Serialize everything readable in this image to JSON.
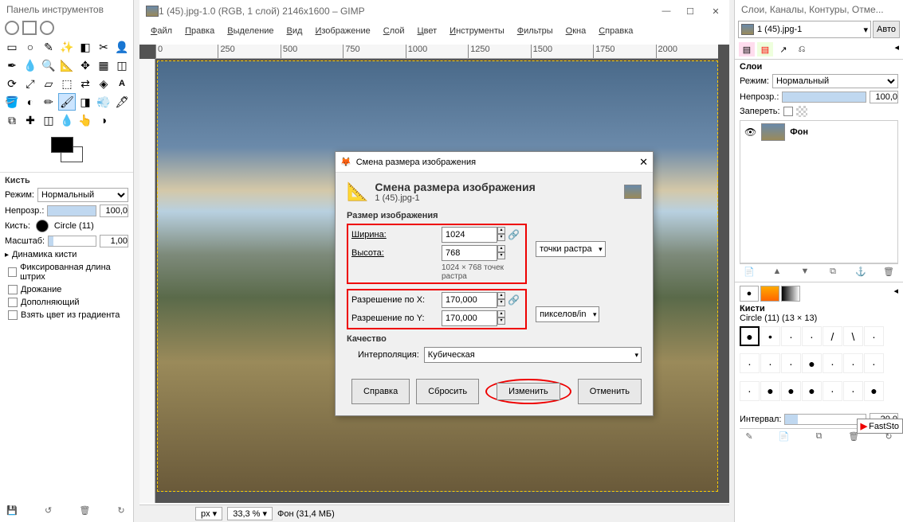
{
  "toolbox": {
    "title": "Панель инструментов",
    "brush_section": "Кисть",
    "mode_label": "Режим:",
    "mode_value": "Нормальный",
    "opacity_label": "Непрозр.:",
    "opacity_value": "100,0",
    "brush_label": "Кисть:",
    "brush_value": "Circle (11)",
    "scale_label": "Масштаб:",
    "scale_value": "1,00",
    "dynamics_label": "Динамика кисти",
    "opt1": "Фиксированная длина штрих",
    "opt2": "Дрожание",
    "opt3": "Дополняющий",
    "opt4": "Взять цвет из градиента"
  },
  "main": {
    "title": "1 (45).jpg-1.0 (RGB, 1 слой) 2146x1600 – GIMP",
    "menu": [
      "Файл",
      "Правка",
      "Выделение",
      "Вид",
      "Изображение",
      "Слой",
      "Цвет",
      "Инструменты",
      "Фильтры",
      "Окна",
      "Справка"
    ],
    "ruler_ticks": [
      "0",
      "250",
      "500",
      "750",
      "1000",
      "1250",
      "1500",
      "1750",
      "2000"
    ],
    "status_unit": "px",
    "status_zoom": "33,3 %",
    "status_info": "Фон (31,4 МБ)"
  },
  "dialog": {
    "win_title": "Смена размера изображения",
    "header_title": "Смена размера изображения",
    "header_file": "1 (45).jpg-1",
    "section_size": "Размер изображения",
    "width_label": "Ширина:",
    "width_value": "1024",
    "height_label": "Высота:",
    "height_value": "768",
    "pixel_note": "1024 × 768 точек растра",
    "unit1_label": "точки растра",
    "res_x_label": "Разрешение по X:",
    "res_x_value": "170,000",
    "res_y_label": "Разрешение по Y:",
    "res_y_value": "170,000",
    "unit2_label": "пикселов/in",
    "section_quality": "Качество",
    "interp_label": "Интерполяция:",
    "interp_value": "Кубическая",
    "btn_help": "Справка",
    "btn_reset": "Сбросить",
    "btn_change": "Изменить",
    "btn_cancel": "Отменить"
  },
  "dock": {
    "title": "Слои, Каналы, Контуры, Отме...",
    "image_name": "1 (45).jpg-1",
    "auto": "Авто",
    "layers_title": "Слои",
    "mode_label": "Режим:",
    "mode_value": "Нормальный",
    "opacity_label": "Непрозр.:",
    "opacity_value": "100,0",
    "lock_label": "Запереть:",
    "layer_name": "Фон",
    "brushes_title": "Кисти",
    "brush_info": "Circle (11) (13 × 13)",
    "interval_label": "Интервал:",
    "interval_value": "20,0",
    "faststone": "FastSto"
  }
}
